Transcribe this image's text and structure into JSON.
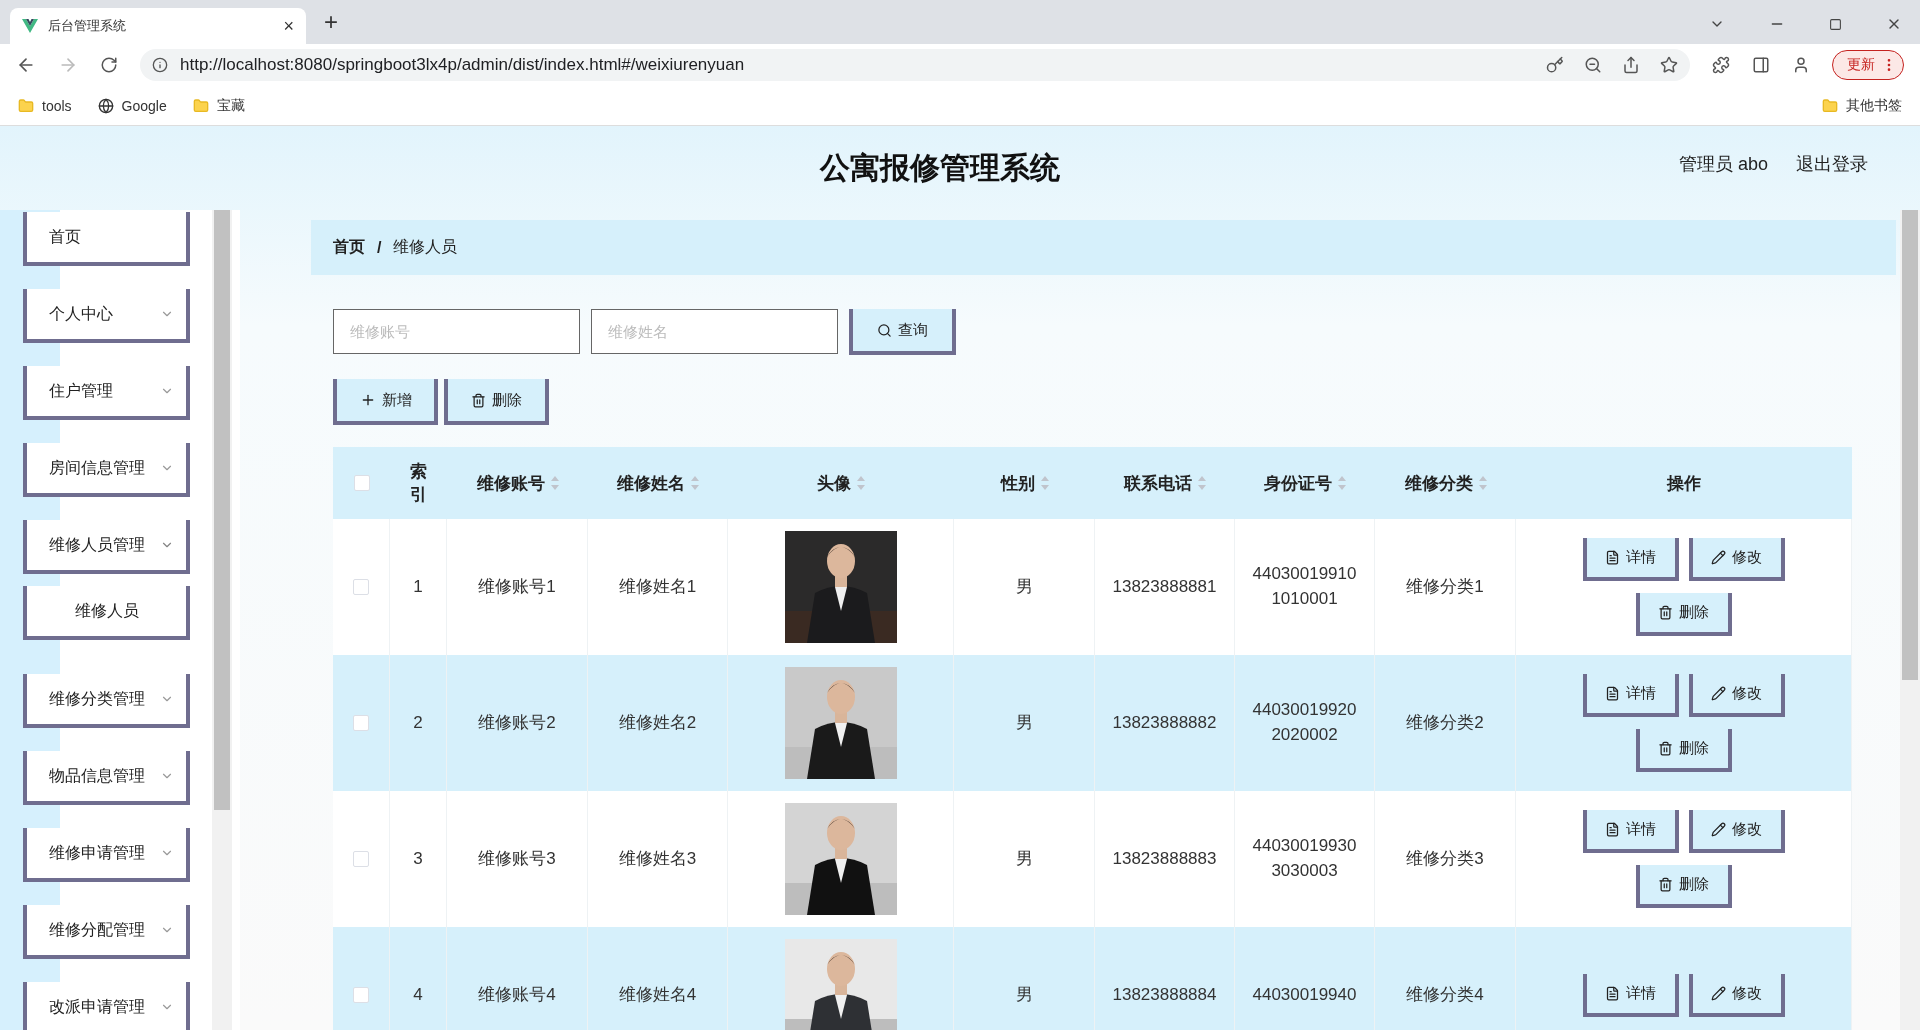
{
  "browser": {
    "tab_title": "后台管理系统",
    "tab_close": "×",
    "new_tab": "+",
    "url": "http://localhost:8080/springboot3lx4p/admin/dist/index.html#/weixiurenyuan",
    "update_button": "更新",
    "bookmarks": [
      {
        "label": "tools",
        "kind": "folder"
      },
      {
        "label": "Google",
        "kind": "globe"
      },
      {
        "label": "宝藏",
        "kind": "folder"
      }
    ],
    "other_bookmarks": "其他书签"
  },
  "header": {
    "title": "公寓报修管理系统",
    "user": "管理员 abo",
    "logout": "退出登录"
  },
  "sidebar": {
    "items": [
      {
        "label": "首页",
        "kind": "link"
      },
      {
        "label": "个人中心",
        "kind": "menu",
        "expanded": false
      },
      {
        "label": "住户管理",
        "kind": "menu",
        "expanded": false
      },
      {
        "label": "房间信息管理",
        "kind": "menu",
        "expanded": false
      },
      {
        "label": "维修人员管理",
        "kind": "menu",
        "expanded": true,
        "children": [
          {
            "label": "维修人员"
          }
        ]
      },
      {
        "label": "维修分类管理",
        "kind": "menu",
        "expanded": false
      },
      {
        "label": "物品信息管理",
        "kind": "menu",
        "expanded": false
      },
      {
        "label": "维修申请管理",
        "kind": "menu",
        "expanded": false
      },
      {
        "label": "维修分配管理",
        "kind": "menu",
        "expanded": false
      },
      {
        "label": "改派申请管理",
        "kind": "menu",
        "expanded": false
      }
    ]
  },
  "breadcrumb": [
    "首页",
    "维修人员"
  ],
  "breadcrumb_separator": "/",
  "search": {
    "fields": [
      {
        "placeholder": "维修账号"
      },
      {
        "placeholder": "维修姓名"
      }
    ],
    "button": "查询"
  },
  "actions": [
    {
      "label": "新增",
      "kind": "add"
    },
    {
      "label": "删除",
      "kind": "delete"
    }
  ],
  "table": {
    "select_all": {
      "checked": false
    },
    "columns": [
      {
        "label": "索引",
        "sortable": false
      },
      {
        "label": "维修账号",
        "sortable": true
      },
      {
        "label": "维修姓名",
        "sortable": true
      },
      {
        "label": "头像",
        "sortable": true
      },
      {
        "label": "性别",
        "sortable": true
      },
      {
        "label": "联系电话",
        "sortable": true
      },
      {
        "label": "身份证号",
        "sortable": true
      },
      {
        "label": "维修分类",
        "sortable": true
      },
      {
        "label": "操作",
        "sortable": false
      }
    ],
    "rows": [
      {
        "checked": false,
        "index": "1",
        "account": "维修账号1",
        "name": "维修姓名1",
        "avatar": {
          "kind": "picture"
        },
        "gender": "男",
        "phone": "13823888881",
        "id_number": "440300199101010001",
        "category": "维修分类1",
        "buttons": [
          {
            "label": "详情",
            "kind": "detail"
          },
          {
            "label": "修改",
            "kind": "edit"
          },
          {
            "label": "删除",
            "kind": "delete"
          }
        ]
      },
      {
        "checked": false,
        "index": "2",
        "account": "维修账号2",
        "name": "维修姓名2",
        "avatar": {
          "kind": "picture"
        },
        "gender": "男",
        "phone": "13823888882",
        "id_number": "440300199202020002",
        "category": "维修分类2",
        "buttons": [
          {
            "label": "详情",
            "kind": "detail"
          },
          {
            "label": "修改",
            "kind": "edit"
          },
          {
            "label": "删除",
            "kind": "delete"
          }
        ]
      },
      {
        "checked": false,
        "index": "3",
        "account": "维修账号3",
        "name": "维修姓名3",
        "avatar": {
          "kind": "picture"
        },
        "gender": "男",
        "phone": "13823888883",
        "id_number": "440300199303030003",
        "category": "维修分类3",
        "buttons": [
          {
            "label": "详情",
            "kind": "detail"
          },
          {
            "label": "修改",
            "kind": "edit"
          },
          {
            "label": "删除",
            "kind": "delete"
          }
        ]
      },
      {
        "checked": false,
        "index": "4",
        "account": "维修账号4",
        "name": "维修姓名4",
        "avatar": {
          "kind": "picture"
        },
        "gender": "男",
        "phone": "13823888884",
        "id_number": "44030019940",
        "category": "维修分类4",
        "buttons": [
          {
            "label": "详情",
            "kind": "detail"
          },
          {
            "label": "修改",
            "kind": "edit"
          }
        ]
      }
    ]
  }
}
